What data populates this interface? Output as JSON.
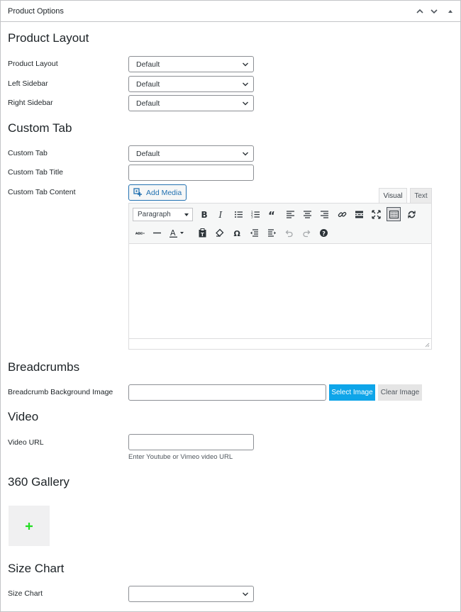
{
  "panel": {
    "title": "Product Options"
  },
  "sections": {
    "product_layout": "Product Layout",
    "custom_tab": "Custom Tab",
    "breadcrumbs": "Breadcrumbs",
    "video": "Video",
    "gallery": "360 Gallery",
    "size_chart": "Size Chart"
  },
  "fields": {
    "product_layout": {
      "label": "Product Layout",
      "value": "Default"
    },
    "left_sidebar": {
      "label": "Left Sidebar",
      "value": "Default"
    },
    "right_sidebar": {
      "label": "Right Sidebar",
      "value": "Default"
    },
    "custom_tab": {
      "label": "Custom Tab",
      "value": "Default"
    },
    "custom_tab_title": {
      "label": "Custom Tab Title",
      "value": ""
    },
    "custom_tab_content": {
      "label": "Custom Tab Content"
    },
    "breadcrumb_bg": {
      "label": "Breadcrumb Background Image",
      "value": ""
    },
    "video_url": {
      "label": "Video URL",
      "value": "",
      "hint": "Enter Youtube or Vimeo video URL"
    },
    "size_chart": {
      "label": "Size Chart",
      "value": ""
    }
  },
  "editor": {
    "add_media": "Add Media",
    "tab_visual": "Visual",
    "tab_text": "Text",
    "format": "Paragraph",
    "tools_row1": [
      "bold-icon",
      "italic-icon",
      "bullet-list-icon",
      "numbered-list-icon",
      "blockquote-icon",
      "align-left-icon",
      "align-center-icon",
      "align-right-icon",
      "link-icon",
      "read-more-icon",
      "fullscreen-icon",
      "toolbar-toggle-icon",
      "refresh-icon"
    ],
    "tools_row2": [
      "strikethrough-icon",
      "horizontal-line-icon",
      "text-color-icon",
      "paste-text-icon",
      "clear-formatting-icon",
      "special-character-icon",
      "outdent-icon",
      "indent-icon",
      "undo-icon",
      "redo-icon",
      "help-icon"
    ]
  },
  "buttons": {
    "select_image": "Select Image",
    "clear_image": "Clear Image"
  },
  "colors": {
    "accent": "#2271b1",
    "select_image_bg": "#0ea5e9",
    "gallery_plus": "#22dd22"
  }
}
